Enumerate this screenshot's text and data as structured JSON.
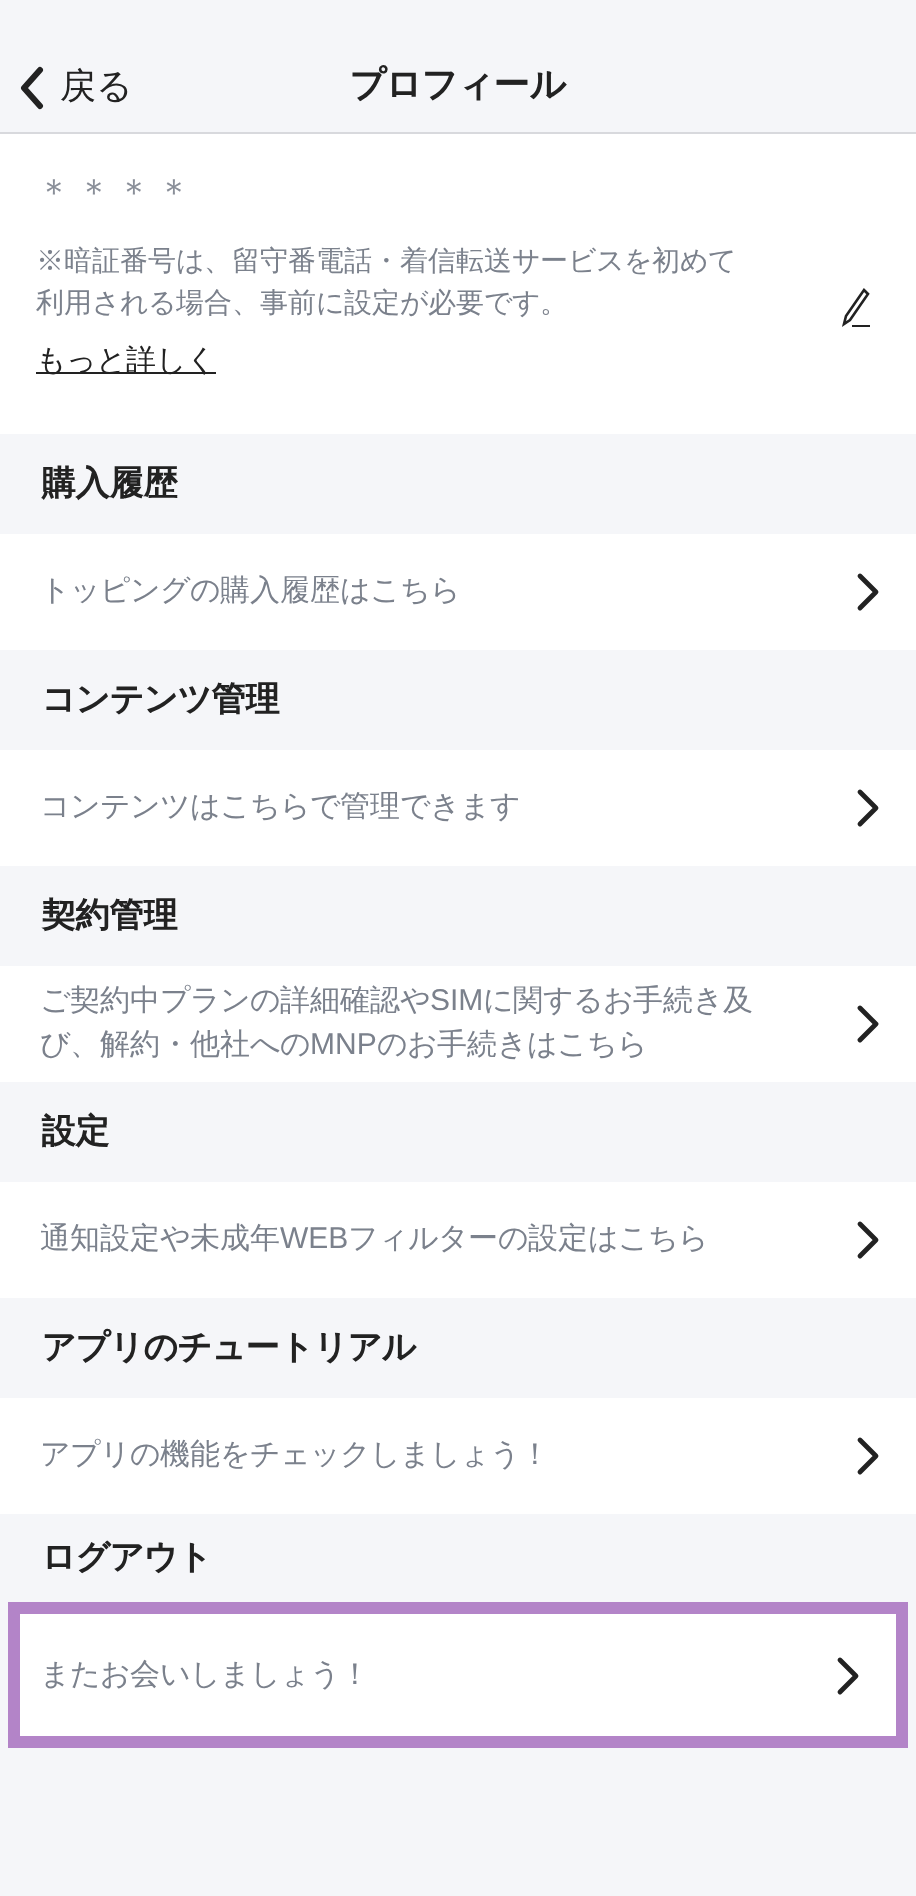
{
  "nav": {
    "back_label": "戻る",
    "title": "プロフィール"
  },
  "pin": {
    "value": "＊＊＊＊",
    "note": "※暗証番号は、留守番電話・着信転送サービスを初めて利用される場合、事前に設定が必要です。",
    "link": "もっと詳しく"
  },
  "sections": [
    {
      "heading": "購入履歴",
      "row": "トッピングの購入履歴はこちら",
      "highlighted": false
    },
    {
      "heading": "コンテンツ管理",
      "row": "コンテンツはこちらで管理できます",
      "highlighted": false
    },
    {
      "heading": "契約管理",
      "row": "ご契約中プランの詳細確認やSIMに関するお手続き及び、解約・他社へのMNPのお手続きはこちら",
      "highlighted": false
    },
    {
      "heading": "設定",
      "row": "通知設定や未成年WEBフィルターの設定はこちら",
      "highlighted": false
    },
    {
      "heading": "アプリのチュートリアル",
      "row": "アプリの機能をチェックしましょう！",
      "highlighted": false
    },
    {
      "heading": "ログアウト",
      "row": "またお会いしましょう！",
      "highlighted": true
    }
  ]
}
